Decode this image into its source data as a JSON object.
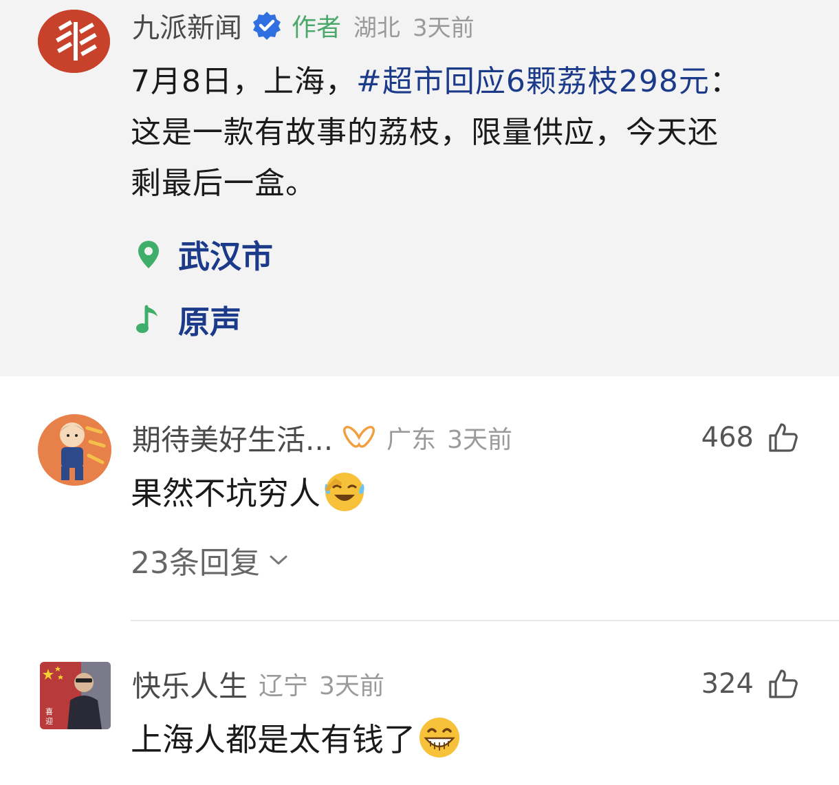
{
  "post": {
    "author": "九派新闻",
    "author_tag": "作者",
    "region": "湖北",
    "time": "3天前",
    "text_lines": [
      {
        "prefix": "7月8日，上海，",
        "hashtag": "#超市回应6颗荔枝298元",
        "suffix": "："
      },
      {
        "text": "这是一款有故事的荔枝，限量供应，今天还"
      },
      {
        "text": "剩最后一盒。"
      }
    ],
    "location_label": "武汉市",
    "audio_label": "原声"
  },
  "comments": [
    {
      "name": "期待美好生活...",
      "region": "广东",
      "time": "3天前",
      "likes": "468",
      "text": "果然不坑穷人",
      "replies": "23条回复"
    },
    {
      "name": "快乐人生",
      "region": "辽宁",
      "time": "3天前",
      "likes": "324",
      "text": "上海人都是太有钱了"
    }
  ],
  "icons": {
    "verified": "verified-badge-icon",
    "location": "location-pin-icon",
    "audio": "music-note-icon",
    "like": "thumbs-up-icon",
    "expand": "chevron-down-icon"
  },
  "colors": {
    "hashtag": "#1c3a8a",
    "author_tag": "#4aa86a",
    "verified": "#2f6fe0",
    "post_bg": "#f3f3f3"
  }
}
